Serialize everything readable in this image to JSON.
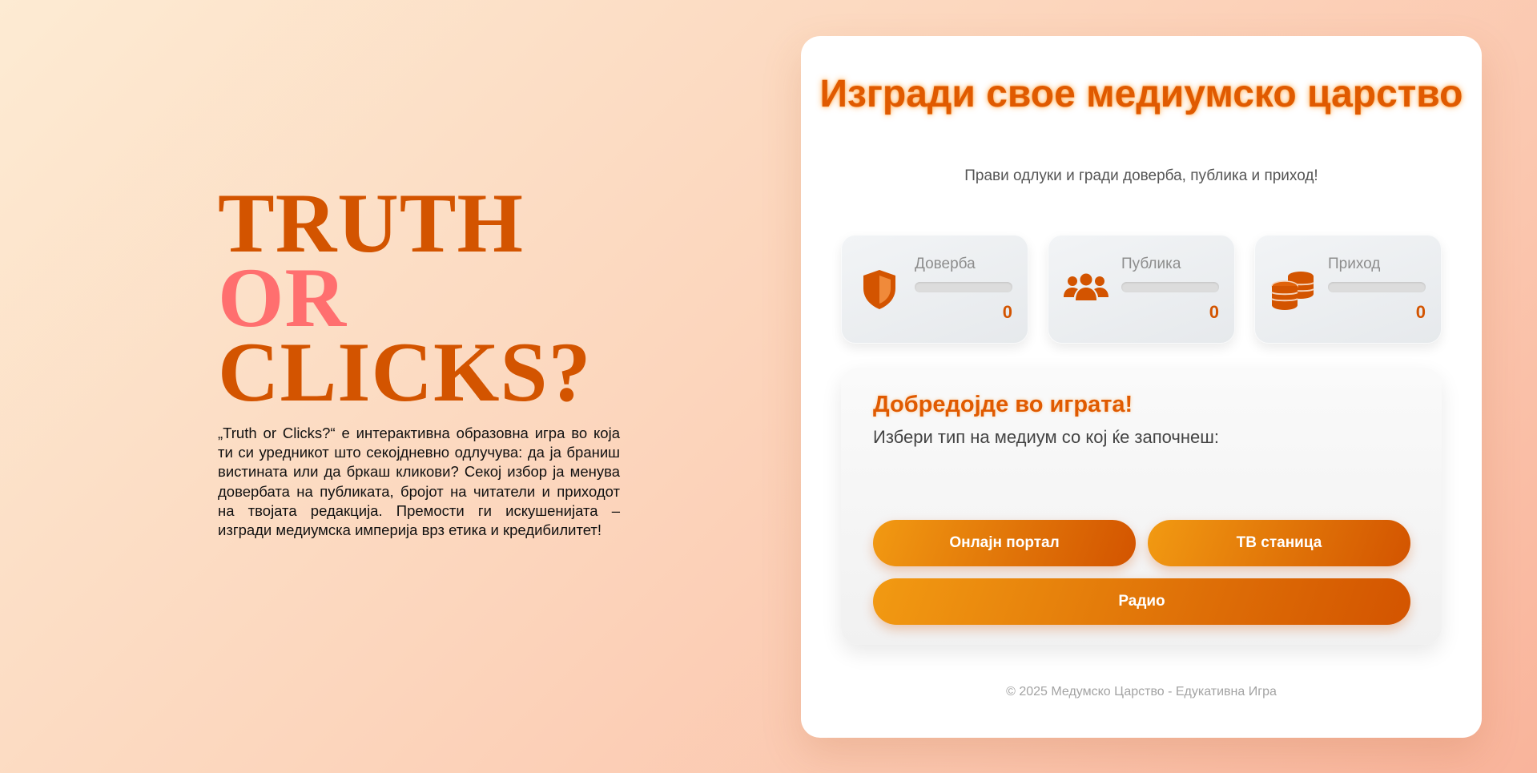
{
  "intro": {
    "logo_truth": "TRUTH",
    "logo_or": "OR",
    "logo_clicks": "CLICKS?",
    "description": "„Truth or Clicks?“ е интерактивна образовна игра во која ти си уредникот што секојдневно одлучува: да ја браниш вистината или да бркаш кликови? Секој избор ја менува довербата на публиката, бројот на читатели и приходот на твојата редакција. Премости ги искушенијата – изгради медиумска империја врз етика и кредибилитет!"
  },
  "card": {
    "title": "Изгради свое медиумско царство",
    "subtitle": "Прави одлуки и гради доверба, публика и приход!"
  },
  "stats": {
    "trust": {
      "label": "Доверба",
      "value": "0",
      "level": 0,
      "icon": "shield-icon"
    },
    "audience": {
      "label": "Публика",
      "value": "0",
      "level": 0,
      "icon": "users-icon"
    },
    "income": {
      "label": "Приход",
      "value": "0",
      "level": 0,
      "icon": "coins-icon"
    }
  },
  "panel": {
    "title": "Добредојде во играта!",
    "text": "Избери тип на медиум со кој ќе започнеш:",
    "buttons": {
      "online": "Онлајн портал",
      "tv": "ТВ станица",
      "radio": "Радио"
    }
  },
  "footer": {
    "text": "© 2025 Медумско Царство - Едукативна Игра"
  },
  "colors": {
    "accent": "#d35400",
    "accent_light": "#f29a12",
    "or_pink": "#ff6f6f"
  }
}
